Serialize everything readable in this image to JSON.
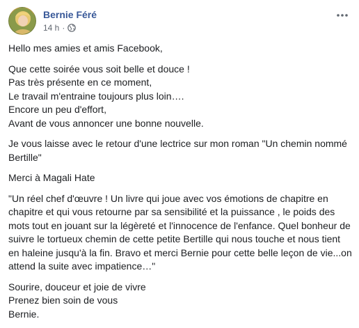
{
  "post": {
    "author": "Bernie Féré",
    "time": "14 h",
    "separator": "·",
    "privacy_icon": "globe-icon",
    "more_icon": "more-dots-icon",
    "paragraphs": [
      "Hello mes amies et amis Facebook,",
      "Que cette soirée vous soit belle et douce !\nPas très présente en ce moment,\nLe travail m'entraine toujours plus loin….\nEncore un peu d'effort,\nAvant de vous annoncer une bonne nouvelle.",
      "Je vous laisse avec le retour d'une lectrice sur mon roman \"Un chemin nommé Bertille\"",
      "Merci à Magali Hate",
      "\"Un réel chef d'œuvre ! Un livre qui joue avec vos émotions de chapitre en chapitre et qui vous retourne par sa sensibilité et la puissance , le poids des mots tout en jouant sur la légèreté et l'innocence de l'enfance. Quel bonheur de suivre le tortueux chemin de cette petite Bertille qui nous touche et nous tient en haleine jusqu'à la fin. Bravo et merci Bernie pour cette belle leçon de vie...on attend la suite avec impatience…\"",
      "Sourire, douceur et joie de vivre\nPrenez bien soin de vous\nBernie."
    ]
  },
  "colors": {
    "author_link": "#385898",
    "meta_text": "#616770",
    "body_text": "#1c1e21"
  }
}
